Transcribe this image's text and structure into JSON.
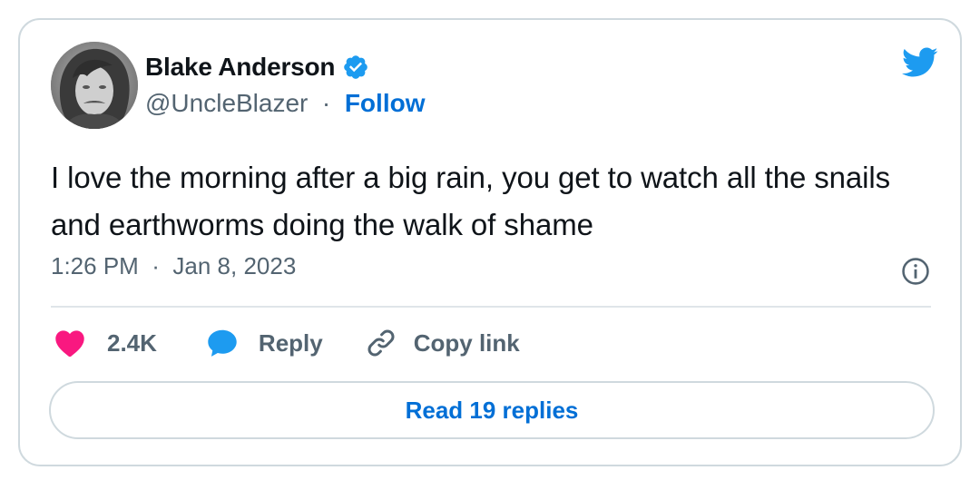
{
  "author": {
    "display_name": "Blake Anderson",
    "handle": "@UncleBlazer",
    "separator": "·",
    "follow_label": "Follow",
    "verified": true
  },
  "tweet": {
    "text": "I love the morning after a big rain, you get to watch all the snails and earthworms doing the walk of shame",
    "time": "1:26 PM",
    "date": "Jan 8, 2023",
    "meta_separator": "·"
  },
  "actions": {
    "like_count": "2.4K",
    "reply_label": "Reply",
    "copy_link_label": "Copy link"
  },
  "read_replies_label": "Read 19 replies",
  "icons": {
    "brand": "twitter-bird-icon",
    "verified": "verified-badge-icon",
    "info": "info-icon",
    "like": "heart-icon",
    "reply": "speech-bubble-icon",
    "copy": "link-icon"
  },
  "colors": {
    "twitter_blue": "#1d9bf0",
    "link_blue": "#006fd6",
    "heart_pink": "#f91880",
    "text_primary": "#0f1419",
    "text_secondary": "#536471",
    "border": "#cfd9de"
  }
}
